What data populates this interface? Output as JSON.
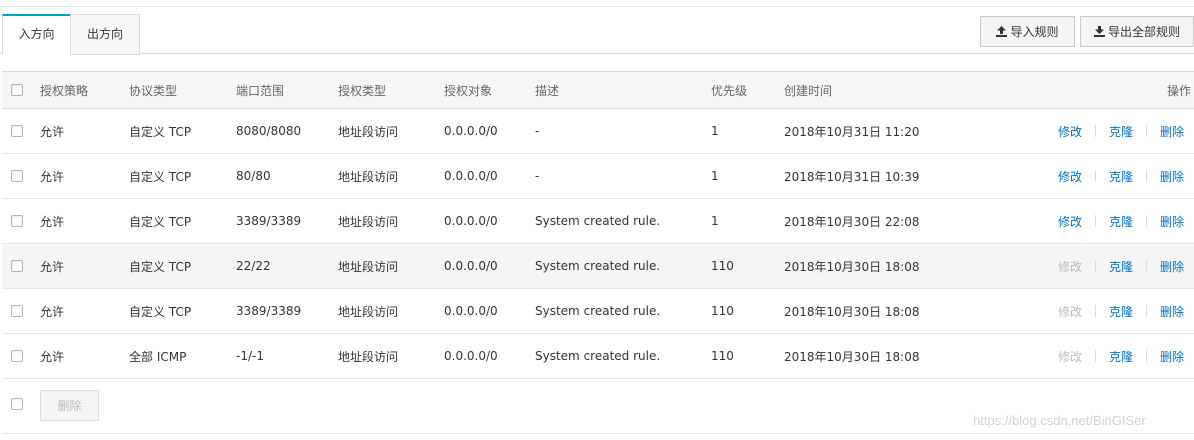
{
  "tabs": [
    {
      "label": "入方向",
      "active": true
    },
    {
      "label": "出方向",
      "active": false
    }
  ],
  "toolbar": {
    "import_label": "导入规则",
    "export_label": "导出全部规则"
  },
  "table": {
    "headers": {
      "policy": "授权策略",
      "protocol": "协议类型",
      "port": "端口范围",
      "auth_type": "授权类型",
      "object": "授权对象",
      "desc": "描述",
      "priority": "优先级",
      "created": "创建时间",
      "ops": "操作"
    },
    "rows": [
      {
        "policy": "允许",
        "protocol": "自定义 TCP",
        "port": "8080/8080",
        "auth_type": "地址段访问",
        "object": "0.0.0.0/0",
        "desc": "-",
        "priority": "1",
        "created": "2018年10月31日 11:20",
        "edit": "修改",
        "clone": "克隆",
        "del": "删除",
        "edit_disabled": false,
        "highlight": false
      },
      {
        "policy": "允许",
        "protocol": "自定义 TCP",
        "port": "80/80",
        "auth_type": "地址段访问",
        "object": "0.0.0.0/0",
        "desc": "-",
        "priority": "1",
        "created": "2018年10月31日 10:39",
        "edit": "修改",
        "clone": "克隆",
        "del": "删除",
        "edit_disabled": false,
        "highlight": false
      },
      {
        "policy": "允许",
        "protocol": "自定义 TCP",
        "port": "3389/3389",
        "auth_type": "地址段访问",
        "object": "0.0.0.0/0",
        "desc": "System created rule.",
        "priority": "1",
        "created": "2018年10月30日 22:08",
        "edit": "修改",
        "clone": "克隆",
        "del": "删除",
        "edit_disabled": false,
        "highlight": false
      },
      {
        "policy": "允许",
        "protocol": "自定义 TCP",
        "port": "22/22",
        "auth_type": "地址段访问",
        "object": "0.0.0.0/0",
        "desc": "System created rule.",
        "priority": "110",
        "created": "2018年10月30日 18:08",
        "edit": "修改",
        "clone": "克隆",
        "del": "删除",
        "edit_disabled": true,
        "highlight": true
      },
      {
        "policy": "允许",
        "protocol": "自定义 TCP",
        "port": "3389/3389",
        "auth_type": "地址段访问",
        "object": "0.0.0.0/0",
        "desc": "System created rule.",
        "priority": "110",
        "created": "2018年10月30日 18:08",
        "edit": "修改",
        "clone": "克隆",
        "del": "删除",
        "edit_disabled": true,
        "highlight": false
      },
      {
        "policy": "允许",
        "protocol": "全部 ICMP",
        "port": "-1/-1",
        "auth_type": "地址段访问",
        "object": "0.0.0.0/0",
        "desc": "System created rule.",
        "priority": "110",
        "created": "2018年10月30日 18:08",
        "edit": "修改",
        "clone": "克隆",
        "del": "删除",
        "edit_disabled": true,
        "highlight": false
      }
    ]
  },
  "footer": {
    "delete_label": "删除"
  },
  "watermark": "https://blog.csdn.net/BinGISer",
  "colors": {
    "accent": "#00a2ca",
    "link": "#0070cc",
    "disabled": "#bbbbbb"
  },
  "icons": {
    "import": "upload-icon",
    "export": "download-icon"
  }
}
